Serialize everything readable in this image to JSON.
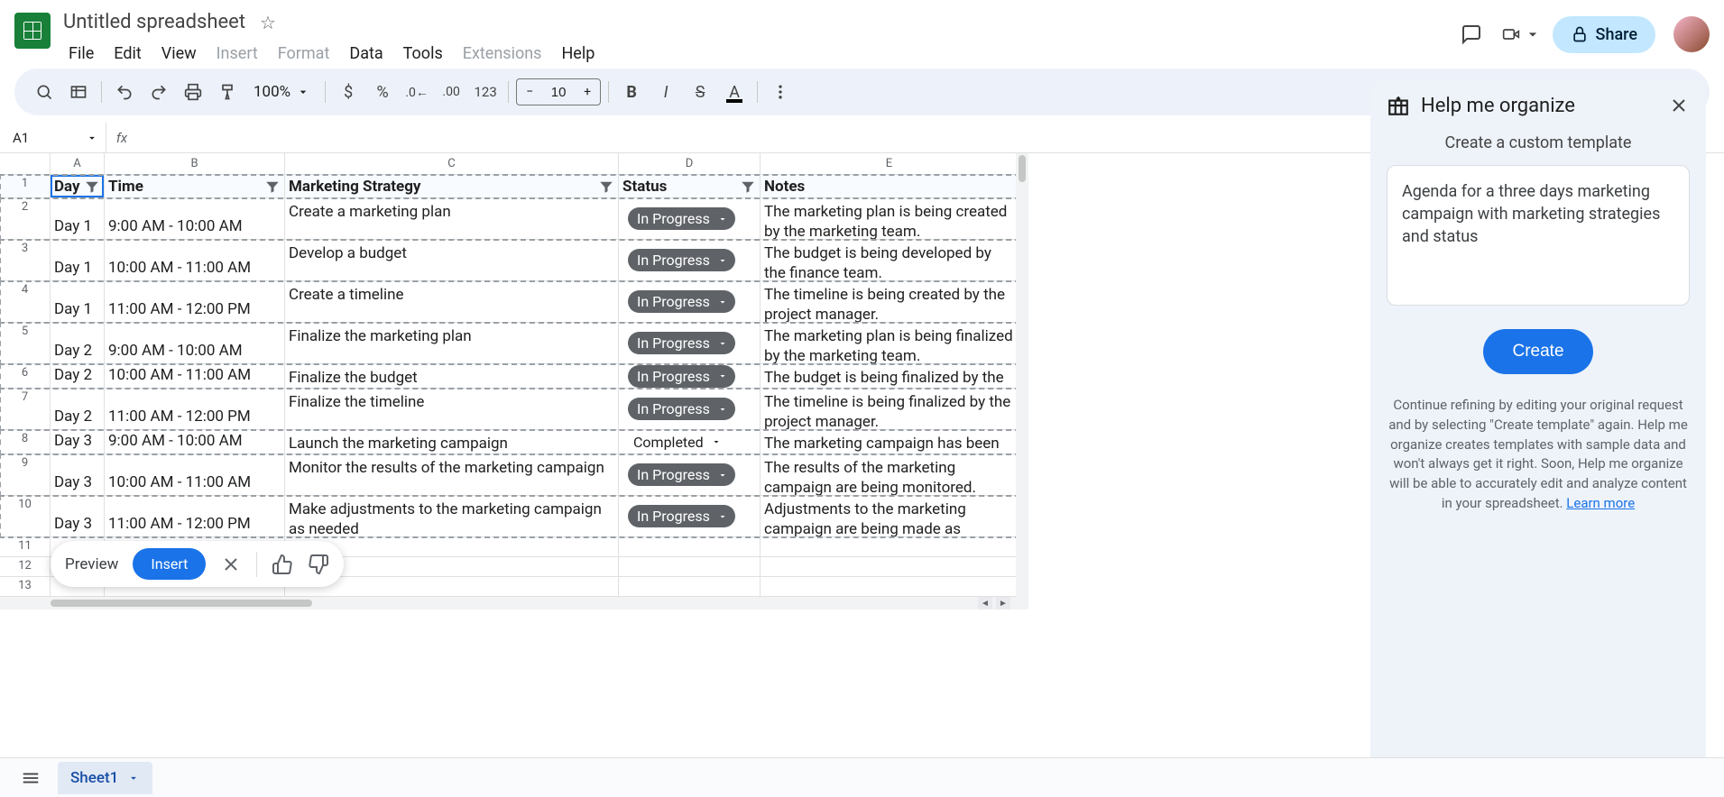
{
  "doc": {
    "title": "Untitled spreadsheet"
  },
  "menus": {
    "file": "File",
    "edit": "Edit",
    "view": "View",
    "insert": "Insert",
    "format": "Format",
    "data": "Data",
    "tools": "Tools",
    "extensions": "Extensions",
    "help": "Help"
  },
  "header": {
    "share": "Share"
  },
  "toolbar": {
    "zoom": "100%",
    "font_size": "10"
  },
  "namebox": {
    "cell": "A1"
  },
  "columns": [
    "A",
    "B",
    "C",
    "D",
    "E"
  ],
  "headers": {
    "day": "Day",
    "time": "Time",
    "strategy": "Marketing Strategy",
    "status": "Status",
    "notes": "Notes"
  },
  "rows": [
    {
      "n": "2",
      "day": "Day 1",
      "time": "9:00 AM - 10:00 AM",
      "strategy": "Create a marketing plan",
      "status": "In Progress",
      "status_type": "progress",
      "notes": "The marketing plan is being created by the marketing team.",
      "h": "tall"
    },
    {
      "n": "3",
      "day": "Day 1",
      "time": "10:00 AM - 11:00 AM",
      "strategy": "Develop a budget",
      "status": "In Progress",
      "status_type": "progress",
      "notes": "The budget is being developed by the finance team.",
      "h": "tall"
    },
    {
      "n": "4",
      "day": "Day 1",
      "time": "11:00 AM - 12:00 PM",
      "strategy": "Create a timeline",
      "status": "In Progress",
      "status_type": "progress",
      "notes": "The timeline is being created by the project manager.",
      "h": "tall"
    },
    {
      "n": "5",
      "day": "Day 2",
      "time": "9:00 AM - 10:00 AM",
      "strategy": "Finalize the marketing plan",
      "status": "In Progress",
      "status_type": "progress",
      "notes": "The marketing plan is being finalized by the marketing team.",
      "h": "tall"
    },
    {
      "n": "6",
      "day": "Day 2",
      "time": "10:00 AM - 11:00 AM",
      "strategy": "Finalize the budget",
      "status": "In Progress",
      "status_type": "progress",
      "notes": "The budget is being finalized by the finance team.",
      "h": "med"
    },
    {
      "n": "7",
      "day": "Day 2",
      "time": "11:00 AM - 12:00 PM",
      "strategy": "Finalize the timeline",
      "status": "In Progress",
      "status_type": "progress",
      "notes": "The timeline is being finalized by the project manager.",
      "h": "tall"
    },
    {
      "n": "8",
      "day": "Day 3",
      "time": "9:00 AM - 10:00 AM",
      "strategy": "Launch the marketing campaign",
      "status": "Completed",
      "status_type": "completed",
      "notes": "The marketing campaign has been launched.",
      "h": "med"
    },
    {
      "n": "9",
      "day": "Day 3",
      "time": "10:00 AM - 11:00 AM",
      "strategy": "Monitor the results of the marketing campaign",
      "status": "In Progress",
      "status_type": "progress",
      "notes": "The results of the marketing campaign are being monitored.",
      "h": "tall"
    },
    {
      "n": "10",
      "day": "Day 3",
      "time": "11:00 AM - 12:00 PM",
      "strategy": "Make adjustments to the marketing campaign as needed",
      "status": "In Progress",
      "status_type": "progress",
      "notes": "Adjustments to the marketing campaign are being made as needed.",
      "h": "tall"
    }
  ],
  "empty_rows": [
    "11",
    "12",
    "13"
  ],
  "preview_bar": {
    "preview": "Preview",
    "insert": "Insert"
  },
  "sidepanel": {
    "title": "Help me organize",
    "subtitle": "Create a custom template",
    "prompt": "Agenda for a three days marketing campaign with marketing strategies and status",
    "create": "Create",
    "help": "Continue refining by editing your original request and by selecting \"Create template\" again. Help me organize creates templates with sample data and won't always get it right. Soon, Help me organize will be able to accurately edit and analyze content in your spreadsheet. ",
    "learn": "Learn more"
  },
  "tabs": {
    "sheet1": "Sheet1"
  }
}
